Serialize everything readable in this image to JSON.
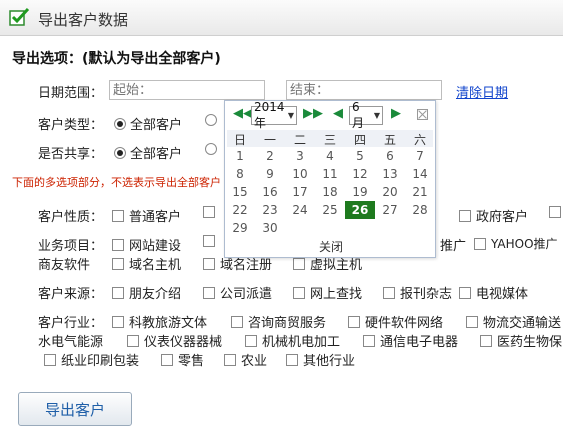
{
  "window": {
    "title": "导出客户数据"
  },
  "options": {
    "heading": "导出选项：(默认为导出全部客户)",
    "date_label": "日期范围：",
    "start_placeholder": "起始：",
    "end_placeholder": "结束：",
    "clear_date": "清除日期",
    "type_label": "客户类型：",
    "type_selected": "全部客户",
    "share_label": "是否共享：",
    "share_selected": "全部客户",
    "note": "下面的多选项部分，不选表示导出全部客户"
  },
  "nature": {
    "label": "客户性质：",
    "items": [
      "普通客户",
      "政府客户"
    ]
  },
  "business": {
    "label": "业务项目：",
    "items": [
      "网站建设",
      "推广",
      "YAHOO推广",
      "商友软件",
      "域名主机",
      "域名注册",
      "虚拟主机"
    ]
  },
  "source": {
    "label": "客户来源：",
    "items": [
      "朋友介绍",
      "公司派遣",
      "网上查找",
      "报刊杂志",
      "电视媒体"
    ]
  },
  "industry": {
    "label": "客户行业：",
    "items": [
      "科教旅游文体",
      "咨询商贸服务",
      "硬件软件网络",
      "物流交通输送",
      "水电气能源",
      "仪表仪器器械",
      "机械机电加工",
      "通信电子电器",
      "医药生物保",
      "纸业印刷包装",
      "零售",
      "农业",
      "其他行业"
    ]
  },
  "export_button": "导出客户",
  "calendar": {
    "year": "2014年",
    "month": "6月",
    "weekdays": [
      "日",
      "一",
      "二",
      "三",
      "四",
      "五",
      "六"
    ],
    "weeks": [
      [
        "1",
        "2",
        "3",
        "4",
        "5",
        "6",
        "7"
      ],
      [
        "8",
        "9",
        "10",
        "11",
        "12",
        "13",
        "14"
      ],
      [
        "15",
        "16",
        "17",
        "18",
        "19",
        "20",
        "21"
      ],
      [
        "22",
        "23",
        "24",
        "25",
        "26",
        "27",
        "28"
      ],
      [
        "29",
        "30",
        "",
        "",
        "",
        "",
        ""
      ]
    ],
    "today": "26",
    "close": "关闭"
  },
  "colors": {
    "today_bg": "#1e7a1e",
    "nav_arrow": "#1a8a3a",
    "link": "#1144cc",
    "note": "#cc2200",
    "button_text": "#1f5fa8"
  }
}
